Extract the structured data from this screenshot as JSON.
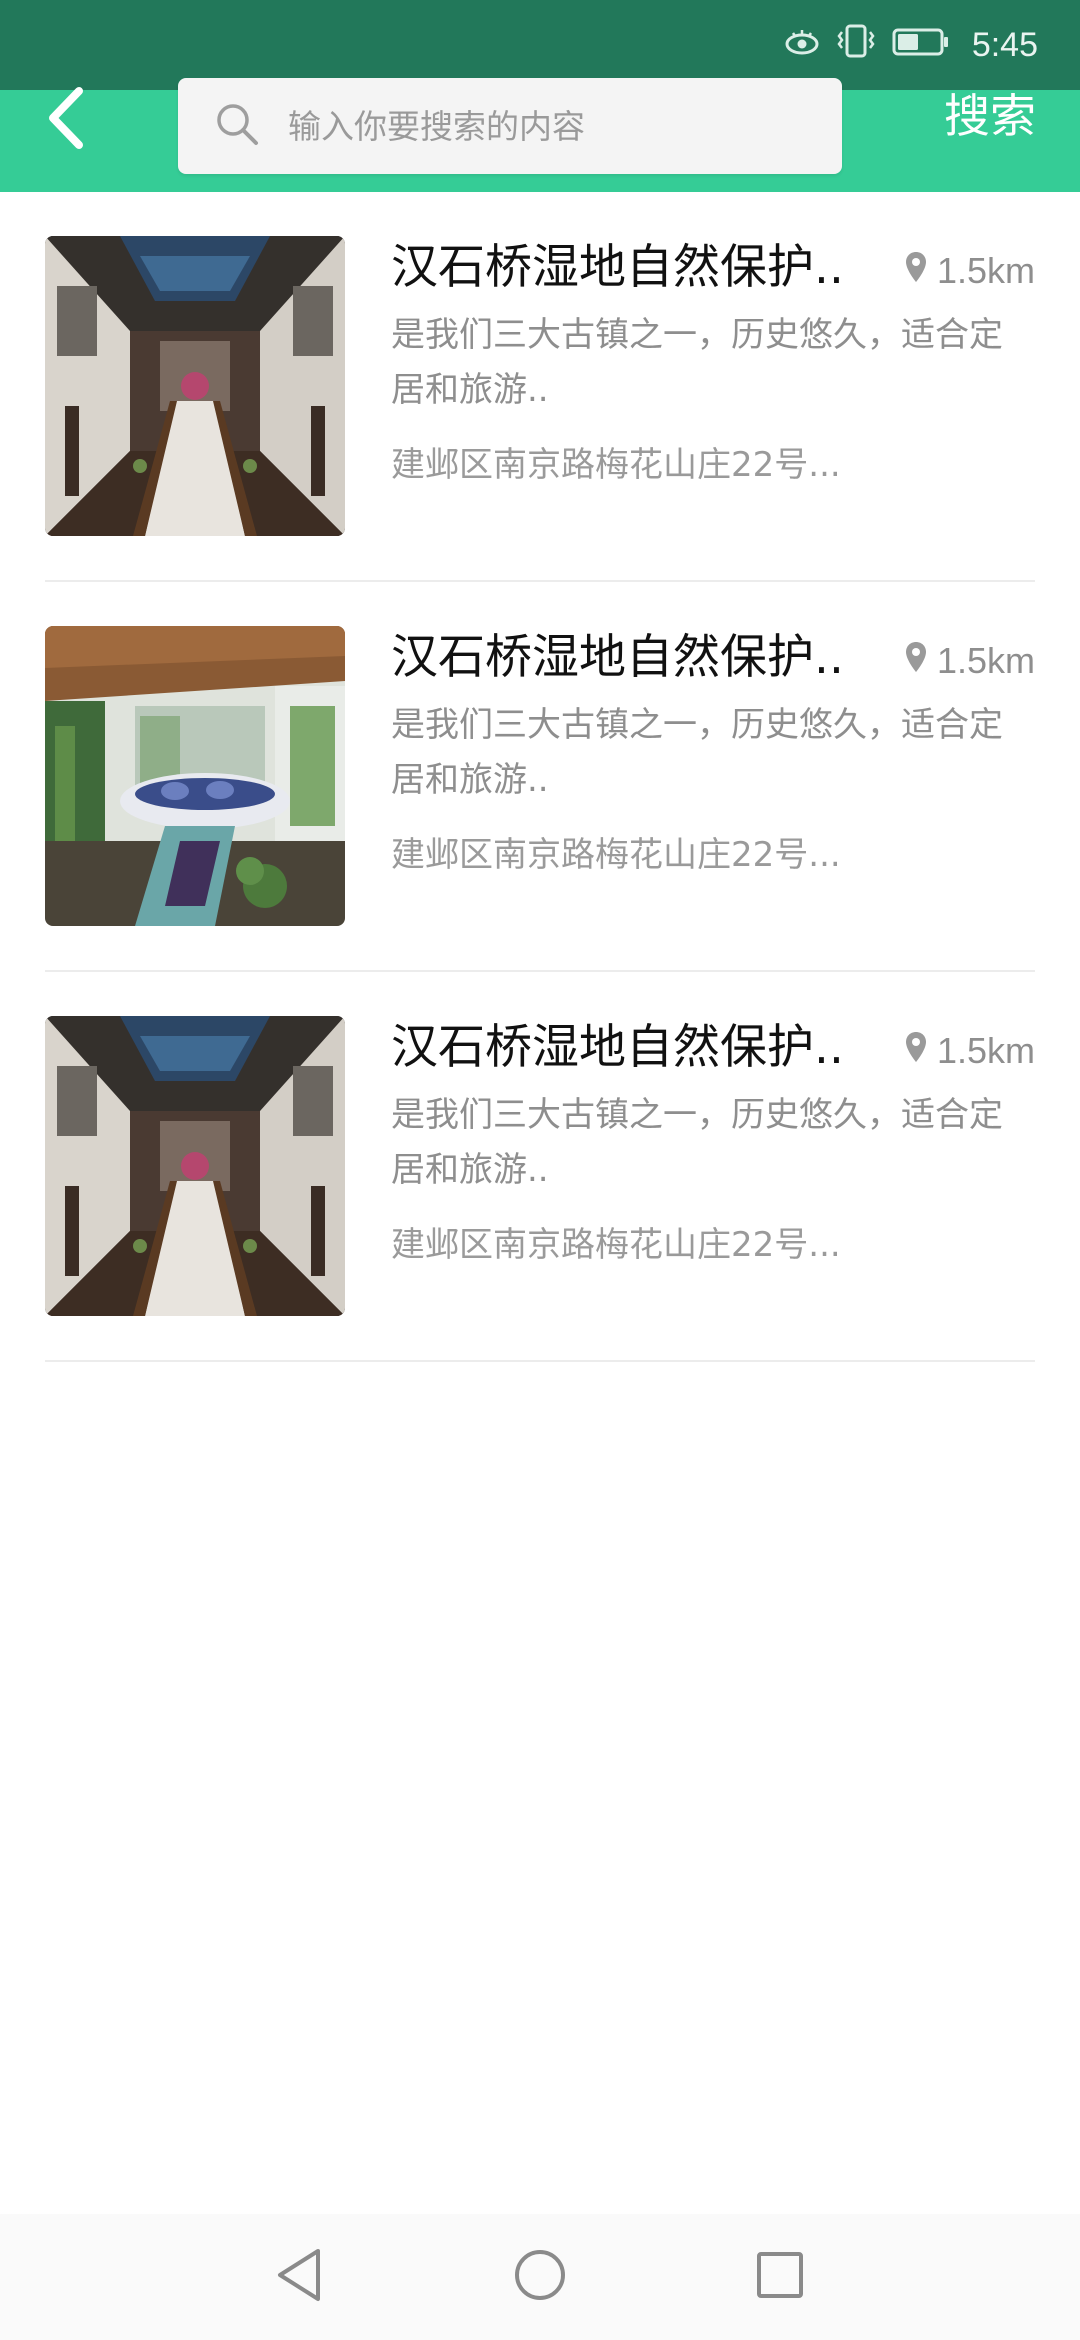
{
  "status_bar": {
    "time": "5:45",
    "icons": [
      "eye-comfort-icon",
      "vibrate-icon",
      "battery-icon"
    ]
  },
  "header": {
    "back_icon": "chevron-left-icon",
    "search_placeholder": "输入你要搜索的内容",
    "search_value": "",
    "search_button_label": "搜索",
    "colors": {
      "status_bar": "#22785a",
      "header": "#35cc96"
    }
  },
  "results": [
    {
      "title": "汉石桥湿地自然保护..",
      "distance": "1.5km",
      "description": "是我们三大古镇之一，历史悠久，适合定居和旅游..",
      "address": "建邺区南京路梅花山庄22号...",
      "image": "hall-interior"
    },
    {
      "title": "汉石桥湿地自然保护..",
      "distance": "1.5km",
      "description": "是我们三大古镇之一，历史悠久，适合定居和旅游..",
      "address": "建邺区南京路梅花山庄22号...",
      "image": "tea-room-interior"
    },
    {
      "title": "汉石桥湿地自然保护..",
      "distance": "1.5km",
      "description": "是我们三大古镇之一，历史悠久，适合定居和旅游..",
      "address": "建邺区南京路梅花山庄22号...",
      "image": "hall-interior"
    }
  ],
  "nav_bar": {
    "icons": [
      "back-triangle-icon",
      "home-circle-icon",
      "recents-square-icon"
    ]
  }
}
